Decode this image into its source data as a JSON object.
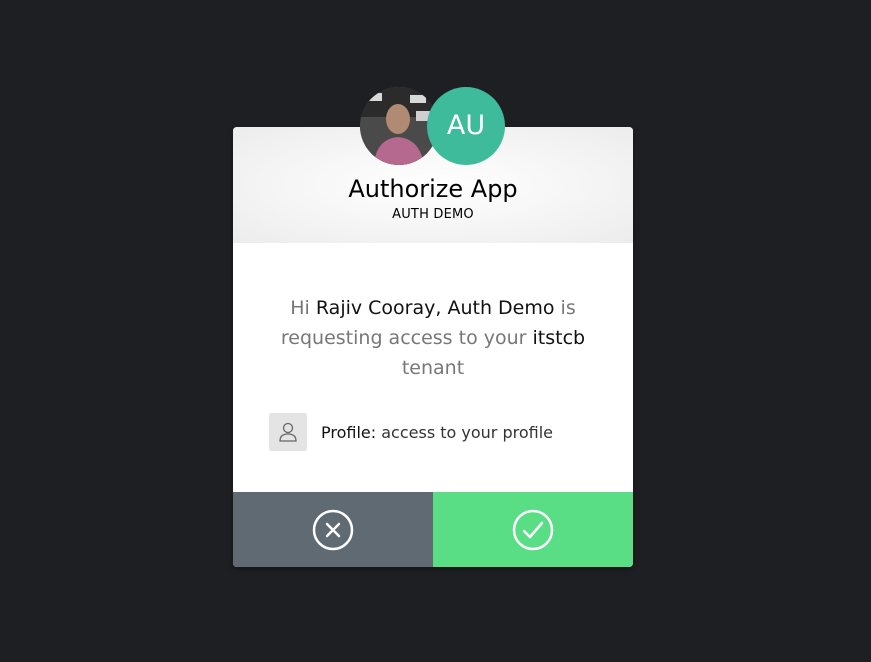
{
  "colors": {
    "background": "#1e1f22",
    "app_avatar": "#3dbb9a",
    "deny_button": "#5f6a72",
    "accept_button": "#59dd85"
  },
  "avatars": {
    "user_icon": "user-photo",
    "app_initials": "AU"
  },
  "header": {
    "title": "Authorize App",
    "subtitle": "AUTH DEMO"
  },
  "message": {
    "greeting": "Hi",
    "user_name": "Rajiv Cooray",
    "app_name": "Auth Demo",
    "requesting": "is requesting access to your",
    "tenant": "itstcb",
    "tenant_suffix": "tenant"
  },
  "scopes": [
    {
      "icon": "user-icon",
      "label": "Profile:",
      "description": "access to your profile"
    }
  ],
  "buttons": {
    "deny_icon": "close-circle-icon",
    "accept_icon": "check-circle-icon"
  }
}
